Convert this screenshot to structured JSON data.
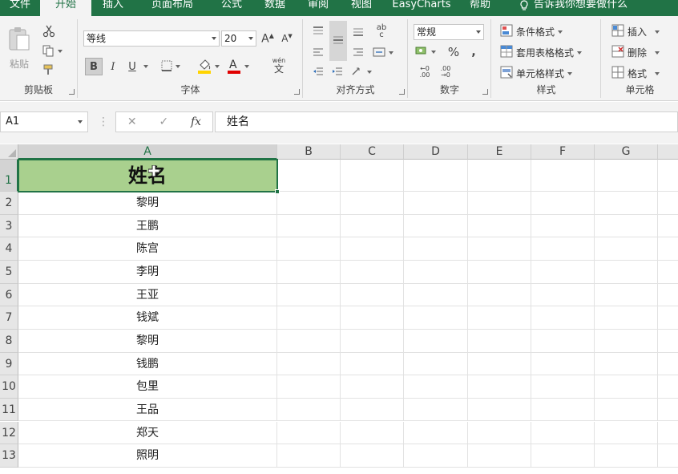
{
  "tabs": [
    {
      "label": "文件",
      "active": false
    },
    {
      "label": "开始",
      "active": true
    },
    {
      "label": "插入",
      "active": false
    },
    {
      "label": "页面布局",
      "active": false
    },
    {
      "label": "公式",
      "active": false
    },
    {
      "label": "数据",
      "active": false
    },
    {
      "label": "审阅",
      "active": false
    },
    {
      "label": "视图",
      "active": false
    },
    {
      "label": "EasyCharts",
      "active": false
    },
    {
      "label": "帮助",
      "active": false
    }
  ],
  "tell_me": "告诉我你想要做什么",
  "ribbon": {
    "clipboard": {
      "label": "剪贴板",
      "paste": "粘贴"
    },
    "font": {
      "label": "字体",
      "font_name": "等线",
      "font_size": "20",
      "bold": "B",
      "italic": "I",
      "underline": "U",
      "wen": "wén",
      "wen_char": "文"
    },
    "alignment": {
      "label": "对齐方式"
    },
    "number": {
      "label": "数字",
      "format": "常规",
      "percent": "%",
      "comma": ","
    },
    "styles": {
      "label": "样式",
      "conditional": "条件格式",
      "table_format": "套用表格格式",
      "cell_styles": "单元格样式"
    },
    "cells": {
      "label": "单元格",
      "insert": "插入",
      "delete": "删除",
      "format": "格式"
    }
  },
  "formula_bar": {
    "name_box": "A1",
    "fx": "fx",
    "content": "姓名"
  },
  "columns": [
    "A",
    "B",
    "C",
    "D",
    "E",
    "F",
    "G"
  ],
  "rows": [
    "1",
    "2",
    "3",
    "4",
    "5",
    "6",
    "7",
    "8",
    "9",
    "10",
    "11",
    "12",
    "13"
  ],
  "cells_a": [
    "姓名",
    "黎明",
    "王鹏",
    "陈宫",
    "李明",
    "王亚",
    "钱斌",
    "黎明",
    "钱鹏",
    "包里",
    "王品",
    "郑天",
    "照明"
  ],
  "colors": {
    "accent": "#217346",
    "header_fill": "#a9d08e"
  }
}
